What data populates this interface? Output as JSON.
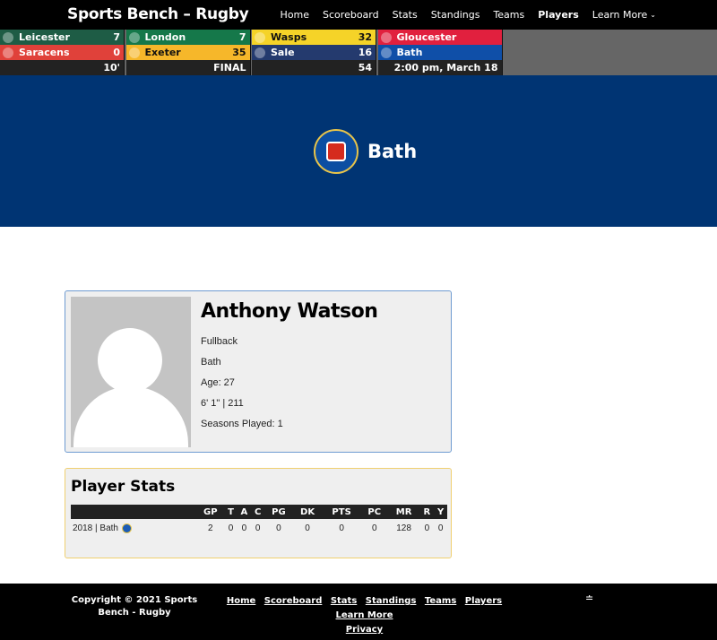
{
  "header": {
    "title": "Sports Bench – Rugby",
    "nav": [
      "Home",
      "Scoreboard",
      "Stats",
      "Standings",
      "Teams",
      "Players",
      "Learn More"
    ],
    "active": "Players"
  },
  "scoreboard": [
    {
      "away": {
        "name": "Leicester",
        "score": "7",
        "color": "#1e5c45"
      },
      "home": {
        "name": "Saracens",
        "score": "0",
        "color": "#e0413a"
      },
      "status": "10'"
    },
    {
      "away": {
        "name": "London",
        "score": "7",
        "color": "#15784a"
      },
      "home": {
        "name": "Exeter",
        "score": "35",
        "color": "#f6b72a"
      },
      "status": "FINAL"
    },
    {
      "away": {
        "name": "Wasps",
        "score": "32",
        "color": "#f5d328"
      },
      "home": {
        "name": "Sale",
        "score": "16",
        "color": "#243a6e"
      },
      "status": "54"
    },
    {
      "away": {
        "name": "Gloucester",
        "score": "",
        "color": "#e1203e"
      },
      "home": {
        "name": "Bath",
        "score": "",
        "color": "#0f4fa8"
      },
      "status": "2:00 pm, March 18"
    }
  ],
  "hero": {
    "team": "Bath",
    "color": "#003473"
  },
  "player": {
    "name": "Anthony Watson",
    "position": "Fullback",
    "team": "Bath",
    "age": "Age: 27",
    "size": "6' 1\" | 211",
    "seasons": "Seasons Played: 1"
  },
  "stats": {
    "title": "Player Stats",
    "headers": [
      "",
      "GP",
      "T",
      "A",
      "C",
      "PG",
      "DK",
      "PTS",
      "PC",
      "MR",
      "R",
      "Y"
    ],
    "rows": [
      {
        "season": "2018 | Bath",
        "values": [
          "2",
          "0",
          "0",
          "0",
          "0",
          "0",
          "0",
          "0",
          "128",
          "0",
          "0"
        ]
      }
    ]
  },
  "footer": {
    "copyright": "Copyright © 2021 Sports Bench - Rugby",
    "links": [
      "Home",
      "Scoreboard",
      "Stats",
      "Standings",
      "Teams",
      "Players",
      "Learn More",
      "Privacy"
    ]
  }
}
